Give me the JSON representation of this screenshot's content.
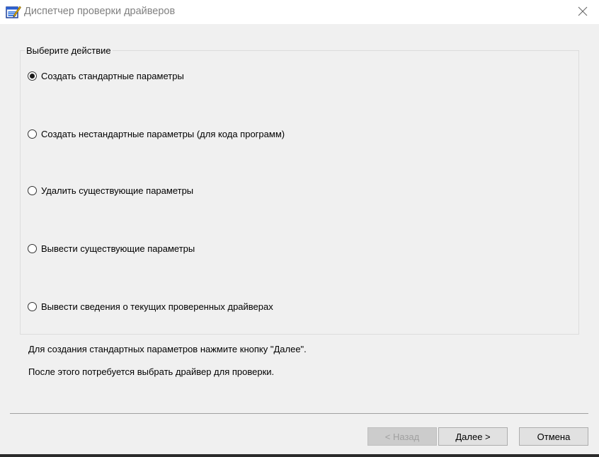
{
  "window": {
    "title": "Диспетчер проверки драйверов"
  },
  "group": {
    "legend": "Выберите действие",
    "options": [
      {
        "label": "Создать стандартные параметры",
        "checked": true
      },
      {
        "label": "Создать нестандартные параметры (для кода программ)",
        "checked": false
      },
      {
        "label": "Удалить существующие параметры",
        "checked": false
      },
      {
        "label": "Вывести существующие параметры",
        "checked": false
      },
      {
        "label": "Вывести сведения о текущих проверенных драйверах",
        "checked": false
      }
    ]
  },
  "info": {
    "line1": "Для создания стандартных параметров нажмите кнопку \"Далее\".",
    "line2": "После этого потребуется выбрать драйвер для проверки."
  },
  "buttons": {
    "back": "< Назад",
    "next": "Далее >",
    "cancel": "Отмена"
  },
  "icons": {
    "app": "driver-verifier-app-icon",
    "close": "close-icon"
  },
  "colors": {
    "title_text": "#808080",
    "dialog_bg": "#f0f0f0",
    "button_bg": "#e1e1e1",
    "disabled_text": "#a0a0a0"
  }
}
